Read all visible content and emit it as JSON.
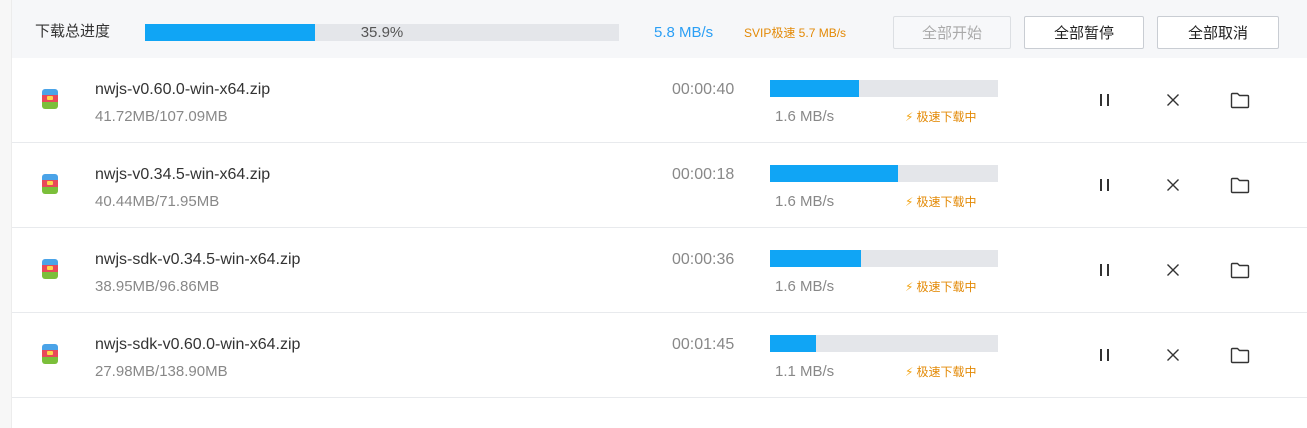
{
  "header": {
    "title": "下载总进度",
    "progress_label": "35.9%",
    "progress": 0.359,
    "speed": "5.8 MB/s",
    "svip_speed": "SVIP极速 5.7 MB/s",
    "buttons": {
      "start_all": "全部开始",
      "pause_all": "全部暂停",
      "cancel_all": "全部取消"
    }
  },
  "fast_label": "极速下载中",
  "downloads": [
    {
      "name": "nwjs-v0.60.0-win-x64.zip",
      "size": "41.72MB/107.09MB",
      "time": "00:00:40",
      "speed": "1.6 MB/s",
      "progress": 0.39
    },
    {
      "name": "nwjs-v0.34.5-win-x64.zip",
      "size": "40.44MB/71.95MB",
      "time": "00:00:18",
      "speed": "1.6 MB/s",
      "progress": 0.56
    },
    {
      "name": "nwjs-sdk-v0.34.5-win-x64.zip",
      "size": "38.95MB/96.86MB",
      "time": "00:00:36",
      "speed": "1.6 MB/s",
      "progress": 0.4
    },
    {
      "name": "nwjs-sdk-v0.60.0-win-x64.zip",
      "size": "27.98MB/138.90MB",
      "time": "00:01:45",
      "speed": "1.1 MB/s",
      "progress": 0.2
    }
  ],
  "icons": {
    "file": "zip-archive-icon",
    "pause": "pause-icon",
    "cancel": "close-icon",
    "folder": "folder-icon",
    "fast": "lightning-icon"
  },
  "colors": {
    "accent": "#10a5f5",
    "speed_text": "#2b9ff5",
    "svip": "#e38a07",
    "track": "#e4e6ea"
  }
}
